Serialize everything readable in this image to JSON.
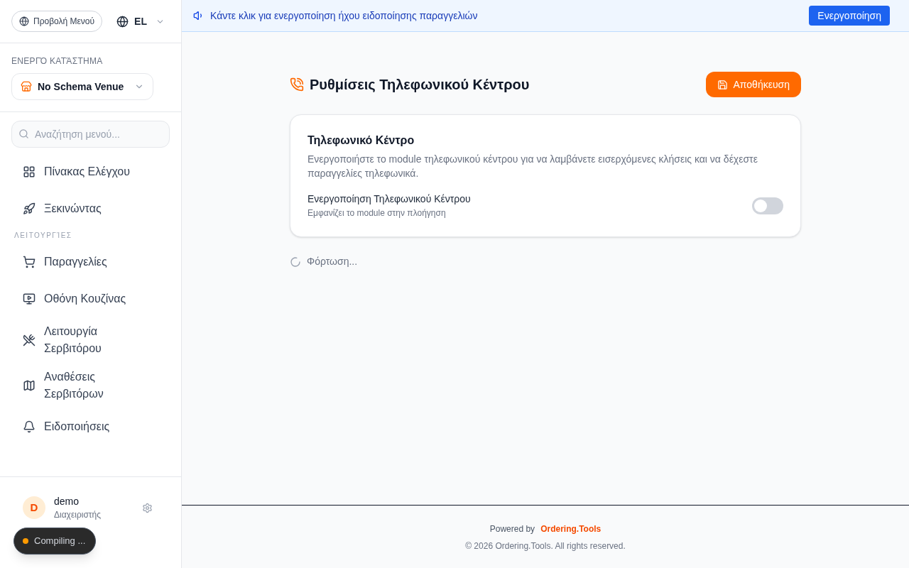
{
  "sidebar": {
    "menu_view_button": "Προβολή Μενού",
    "language": "EL",
    "venue_label": "ΕΝΕΡΓΌ ΚΑΤΆΣΤΗΜΑ",
    "venue": "No Schema Venue",
    "search": {
      "placeholder": "Αναζήτηση μενού..."
    },
    "groups": [
      {
        "items": [
          {
            "label": "Πίνακας Ελέγχου",
            "selected": false
          },
          {
            "label": "Ξεκινώντας",
            "selected": false
          }
        ]
      },
      {
        "heading": "ΛΕΙΤΟΥΡΓΊΕΣ",
        "items": [
          {
            "label": "Παραγγελίες",
            "selected": false
          },
          {
            "label": "Οθόνη Κουζίνας",
            "selected": false
          },
          {
            "label": "Λειτουργία Σερβιτόρου",
            "selected": false
          },
          {
            "label": "Αναθέσεις Σερβιτόρων",
            "selected": false
          },
          {
            "label": "Ειδοποιήσεις",
            "selected": false
          }
        ]
      }
    ],
    "user": {
      "initial": "D",
      "name": "demo",
      "role": "Διαχειριστής"
    }
  },
  "banner": {
    "text": "Κάντε κλικ για ενεργοποίηση ήχου ειδοποίησης παραγγελιών",
    "button": "Ενεργοποίηση"
  },
  "page": {
    "title": "Ρυθμίσεις Τηλεφωνικού Κέντρου",
    "save_button": "Αποθήκευση",
    "card": {
      "title": "Τηλεφωνικό Κέντρο",
      "description": "Ενεργοποιήστε το module τηλεφωνικού κέντρου για να λαμβάνετε εισερχόμενες κλήσεις και να δέχεστε παραγγελίες τηλεφωνικά.",
      "setting": {
        "label": "Ενεργοποίηση Τηλεφωνικού Κέντρου",
        "hint": "Εμφανίζει το module στην πλοήγηση",
        "on": false
      }
    },
    "loading": "Φόρτωση..."
  },
  "footer": {
    "powered_by": "Powered by",
    "brand": "Ordering.Tools",
    "copyright": "© 2026 Ordering.Tools. All rights reserved."
  },
  "toast": {
    "text": "Compiling ..."
  }
}
